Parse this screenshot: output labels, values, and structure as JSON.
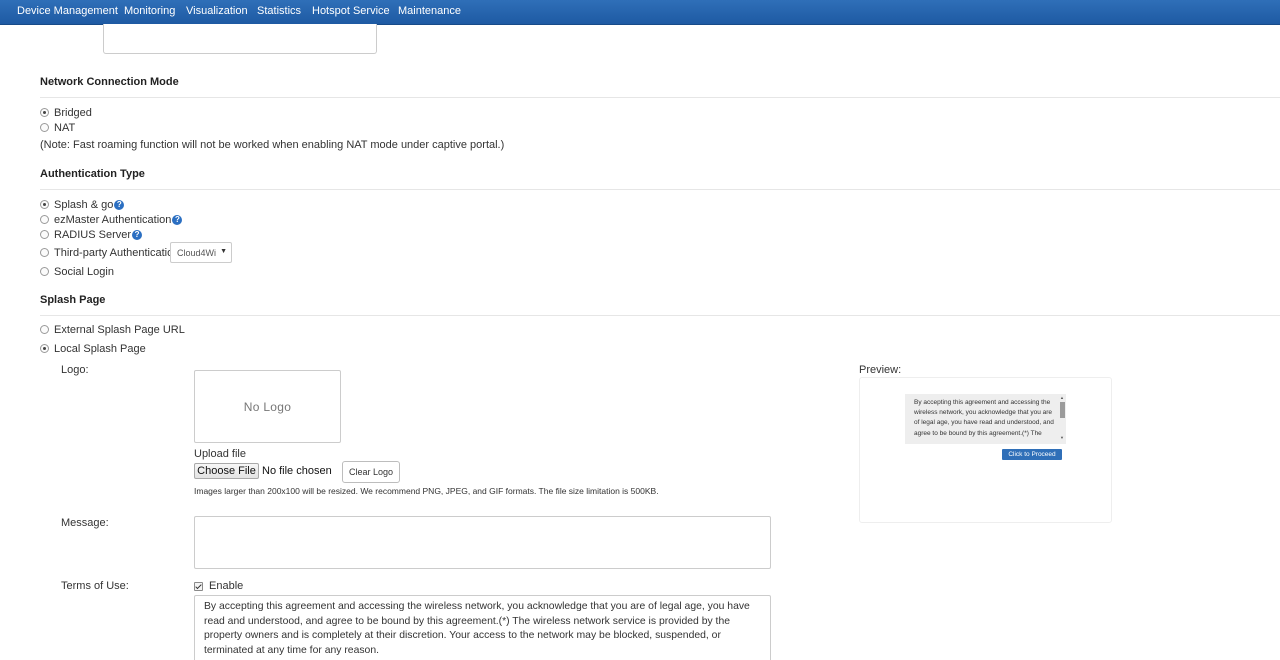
{
  "nav": {
    "items": [
      "Device Management",
      "Monitoring",
      "Visualization",
      "Statistics",
      "Hotspot Service",
      "Maintenance"
    ]
  },
  "network_mode": {
    "title": "Network Connection Mode",
    "options": [
      {
        "label": "Bridged",
        "selected": true
      },
      {
        "label": "NAT",
        "selected": false
      }
    ],
    "note": "(Note: Fast roaming function will not be worked when enabling NAT mode under captive portal.)"
  },
  "auth": {
    "title": "Authentication Type",
    "options": [
      {
        "label": "Splash & go",
        "selected": true,
        "help": true
      },
      {
        "label": "ezMaster Authentication",
        "selected": false,
        "help": true
      },
      {
        "label": "RADIUS Server",
        "selected": false,
        "help": true
      },
      {
        "label": "Third-party Authentication",
        "selected": false,
        "help": false
      },
      {
        "label": "Social Login",
        "selected": false,
        "help": false
      }
    ],
    "help_glyph": "?",
    "third_party_select": "Cloud4Wi"
  },
  "splash": {
    "title": "Splash Page",
    "options": [
      {
        "label": "External Splash Page URL",
        "selected": false
      },
      {
        "label": "Local Splash Page",
        "selected": true
      }
    ],
    "logo_label": "Logo:",
    "no_logo": "No Logo",
    "upload_label": "Upload file",
    "choose_file": "Choose File",
    "file_status": "No file chosen",
    "clear_logo": "Clear Logo",
    "image_hint": "Images larger than 200x100 will be resized. We recommend PNG, JPEG, and GIF formats. The file size limitation is 500KB.",
    "message_label": "Message:",
    "message_value": "",
    "terms_label": "Terms of Use:",
    "terms_enabled": true,
    "enable_label": "Enable",
    "terms_text": "By accepting this agreement and accessing the wireless network, you acknowledge that you are of legal age, you have read and understood, and agree to be bound by this agreement.(*) The wireless network service is provided by the property owners and is completely at their discretion. Your access to the network may be blocked, suspended, or terminated at any time for any reason.",
    "preview_label": "Preview:",
    "preview_text": "By accepting this agreement and accessing the wireless network, you acknowledge that you are of legal age, you have read and understood, and agree to be bound by this agreement.(*) The",
    "proceed_button": "Click to Proceed"
  },
  "colors": {
    "nav_bg": "#2065b0",
    "help_icon": "#2b6fc2",
    "proceed_button": "#2f6fb8"
  }
}
